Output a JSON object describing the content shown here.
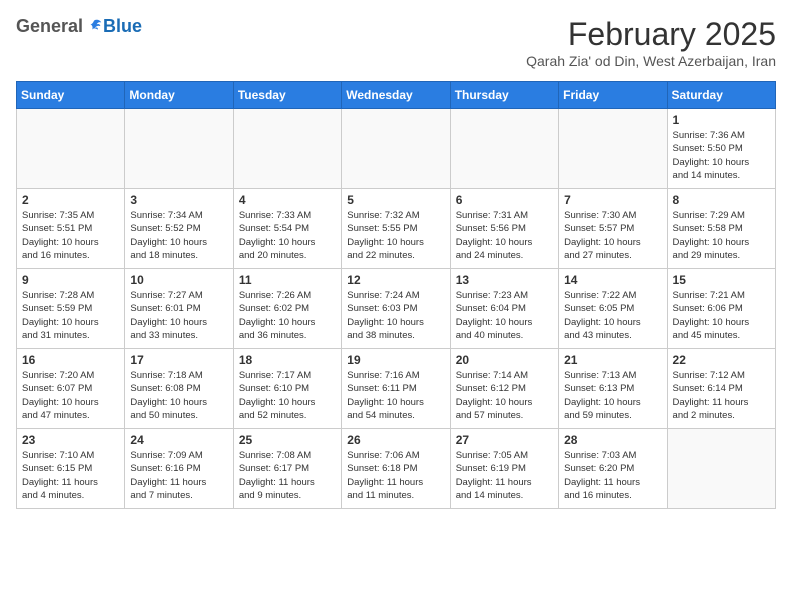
{
  "header": {
    "logo_general": "General",
    "logo_blue": "Blue",
    "month_year": "February 2025",
    "location": "Qarah Zia' od Din, West Azerbaijan, Iran"
  },
  "weekdays": [
    "Sunday",
    "Monday",
    "Tuesday",
    "Wednesday",
    "Thursday",
    "Friday",
    "Saturday"
  ],
  "weeks": [
    [
      {
        "day": "",
        "info": ""
      },
      {
        "day": "",
        "info": ""
      },
      {
        "day": "",
        "info": ""
      },
      {
        "day": "",
        "info": ""
      },
      {
        "day": "",
        "info": ""
      },
      {
        "day": "",
        "info": ""
      },
      {
        "day": "1",
        "info": "Sunrise: 7:36 AM\nSunset: 5:50 PM\nDaylight: 10 hours\nand 14 minutes."
      }
    ],
    [
      {
        "day": "2",
        "info": "Sunrise: 7:35 AM\nSunset: 5:51 PM\nDaylight: 10 hours\nand 16 minutes."
      },
      {
        "day": "3",
        "info": "Sunrise: 7:34 AM\nSunset: 5:52 PM\nDaylight: 10 hours\nand 18 minutes."
      },
      {
        "day": "4",
        "info": "Sunrise: 7:33 AM\nSunset: 5:54 PM\nDaylight: 10 hours\nand 20 minutes."
      },
      {
        "day": "5",
        "info": "Sunrise: 7:32 AM\nSunset: 5:55 PM\nDaylight: 10 hours\nand 22 minutes."
      },
      {
        "day": "6",
        "info": "Sunrise: 7:31 AM\nSunset: 5:56 PM\nDaylight: 10 hours\nand 24 minutes."
      },
      {
        "day": "7",
        "info": "Sunrise: 7:30 AM\nSunset: 5:57 PM\nDaylight: 10 hours\nand 27 minutes."
      },
      {
        "day": "8",
        "info": "Sunrise: 7:29 AM\nSunset: 5:58 PM\nDaylight: 10 hours\nand 29 minutes."
      }
    ],
    [
      {
        "day": "9",
        "info": "Sunrise: 7:28 AM\nSunset: 5:59 PM\nDaylight: 10 hours\nand 31 minutes."
      },
      {
        "day": "10",
        "info": "Sunrise: 7:27 AM\nSunset: 6:01 PM\nDaylight: 10 hours\nand 33 minutes."
      },
      {
        "day": "11",
        "info": "Sunrise: 7:26 AM\nSunset: 6:02 PM\nDaylight: 10 hours\nand 36 minutes."
      },
      {
        "day": "12",
        "info": "Sunrise: 7:24 AM\nSunset: 6:03 PM\nDaylight: 10 hours\nand 38 minutes."
      },
      {
        "day": "13",
        "info": "Sunrise: 7:23 AM\nSunset: 6:04 PM\nDaylight: 10 hours\nand 40 minutes."
      },
      {
        "day": "14",
        "info": "Sunrise: 7:22 AM\nSunset: 6:05 PM\nDaylight: 10 hours\nand 43 minutes."
      },
      {
        "day": "15",
        "info": "Sunrise: 7:21 AM\nSunset: 6:06 PM\nDaylight: 10 hours\nand 45 minutes."
      }
    ],
    [
      {
        "day": "16",
        "info": "Sunrise: 7:20 AM\nSunset: 6:07 PM\nDaylight: 10 hours\nand 47 minutes."
      },
      {
        "day": "17",
        "info": "Sunrise: 7:18 AM\nSunset: 6:08 PM\nDaylight: 10 hours\nand 50 minutes."
      },
      {
        "day": "18",
        "info": "Sunrise: 7:17 AM\nSunset: 6:10 PM\nDaylight: 10 hours\nand 52 minutes."
      },
      {
        "day": "19",
        "info": "Sunrise: 7:16 AM\nSunset: 6:11 PM\nDaylight: 10 hours\nand 54 minutes."
      },
      {
        "day": "20",
        "info": "Sunrise: 7:14 AM\nSunset: 6:12 PM\nDaylight: 10 hours\nand 57 minutes."
      },
      {
        "day": "21",
        "info": "Sunrise: 7:13 AM\nSunset: 6:13 PM\nDaylight: 10 hours\nand 59 minutes."
      },
      {
        "day": "22",
        "info": "Sunrise: 7:12 AM\nSunset: 6:14 PM\nDaylight: 11 hours\nand 2 minutes."
      }
    ],
    [
      {
        "day": "23",
        "info": "Sunrise: 7:10 AM\nSunset: 6:15 PM\nDaylight: 11 hours\nand 4 minutes."
      },
      {
        "day": "24",
        "info": "Sunrise: 7:09 AM\nSunset: 6:16 PM\nDaylight: 11 hours\nand 7 minutes."
      },
      {
        "day": "25",
        "info": "Sunrise: 7:08 AM\nSunset: 6:17 PM\nDaylight: 11 hours\nand 9 minutes."
      },
      {
        "day": "26",
        "info": "Sunrise: 7:06 AM\nSunset: 6:18 PM\nDaylight: 11 hours\nand 11 minutes."
      },
      {
        "day": "27",
        "info": "Sunrise: 7:05 AM\nSunset: 6:19 PM\nDaylight: 11 hours\nand 14 minutes."
      },
      {
        "day": "28",
        "info": "Sunrise: 7:03 AM\nSunset: 6:20 PM\nDaylight: 11 hours\nand 16 minutes."
      },
      {
        "day": "",
        "info": ""
      }
    ]
  ]
}
